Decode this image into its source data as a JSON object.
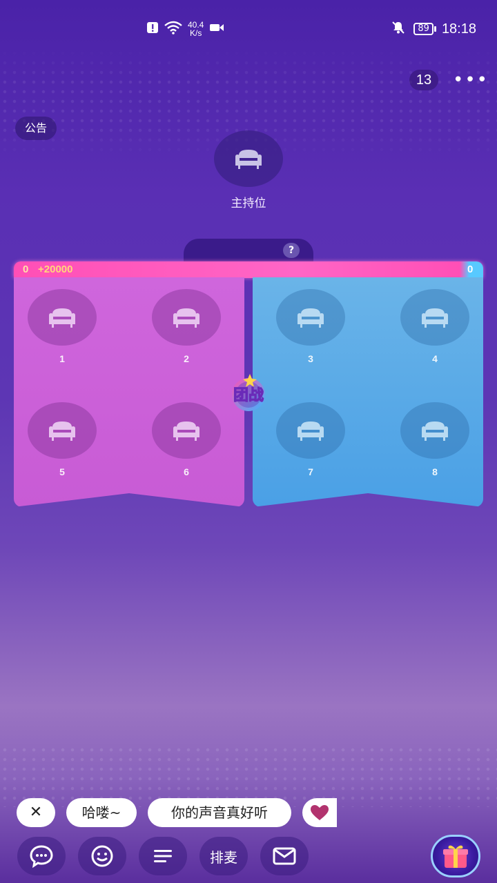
{
  "status_bar": {
    "network_speed_value": "40.4",
    "network_speed_unit": "K/s",
    "battery": "89",
    "time": "18:18",
    "icons": [
      "alert-icon",
      "wifi-icon",
      "video-icon",
      "mute-bell-icon",
      "battery-icon"
    ]
  },
  "header": {
    "online_count": "13",
    "more_label": "•••",
    "notice_label": "公告"
  },
  "host": {
    "label": "主持位"
  },
  "battle": {
    "badge_text": "团战",
    "score_left": "0",
    "score_bonus": "+20000",
    "score_right": "0",
    "help": "?",
    "red_team_seats": [
      "1",
      "2",
      "5",
      "6"
    ],
    "blue_team_seats": [
      "3",
      "4",
      "7",
      "8"
    ],
    "colors": {
      "red": "#c85bd5",
      "blue": "#4aa0e6",
      "bar": "#ff4fb6"
    }
  },
  "quick_phrases": {
    "close_label": "✕",
    "items": [
      "哈喽~",
      "你的声音真好听"
    ]
  },
  "toolbar": {
    "queue_label": "排麦",
    "icons": [
      "chat-icon",
      "emoji-icon",
      "menu-icon",
      "mail-icon",
      "gift-icon"
    ]
  }
}
